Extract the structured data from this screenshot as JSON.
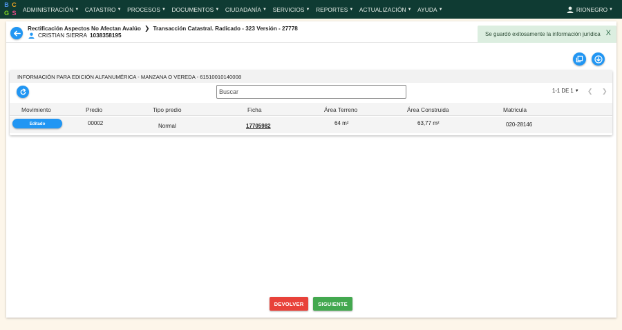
{
  "logo": {
    "letters": [
      "B",
      "C",
      "G",
      "S"
    ]
  },
  "nav": {
    "items": [
      {
        "label": "ADMINISTRACIÓN"
      },
      {
        "label": "CATASTRO"
      },
      {
        "label": "PROCESOS"
      },
      {
        "label": "DOCUMENTOS"
      },
      {
        "label": "CIUDADANÍA"
      },
      {
        "label": "SERVICIOS"
      },
      {
        "label": "REPORTES"
      },
      {
        "label": "ACTUALIZACIÓN"
      },
      {
        "label": "AYUDA"
      }
    ],
    "user": {
      "name": "RIONEGRO",
      "icon": "person-icon"
    }
  },
  "header": {
    "breadcrumb": {
      "first": "Rectificación Aspectos No Afectan Avalúo",
      "second": "Transacción Catastral. Radicado - 323 Versión - 27778"
    },
    "person": {
      "name": "CRISTIAN SIERRA",
      "document": "1038358195"
    }
  },
  "toast": {
    "message": "Se guardó exitosamente la información jurídica",
    "close": "X"
  },
  "panel": {
    "title": "INFORMACIÓN PARA EDICIÓN ALFANUMÉRICA - MANZANA O VEREDA - 61510010140008",
    "search": {
      "placeholder": "Buscar",
      "value": ""
    },
    "pager": {
      "label": "1-1 DE 1"
    },
    "columns": [
      "Movimiento",
      "Predio",
      "Tipo predio",
      "Ficha",
      "Área Terreno",
      "Área Construida",
      "Matricula"
    ],
    "rows": [
      {
        "movimiento": "Editado",
        "predio": "00002",
        "tipo_predio": "Normal",
        "ficha": "17705982",
        "area_terreno": "64 m²",
        "area_construida": "63,77 m²",
        "matricula": "020-28146"
      }
    ]
  },
  "actions": {
    "devolver": "DEVOLVER",
    "siguiente": "SIGUIENTE"
  },
  "colors": {
    "nav_bg": "#0f3b33",
    "primary": "#2196f3",
    "danger": "#e8423a",
    "success": "#43a84f",
    "toast_bg": "#dceee0"
  }
}
